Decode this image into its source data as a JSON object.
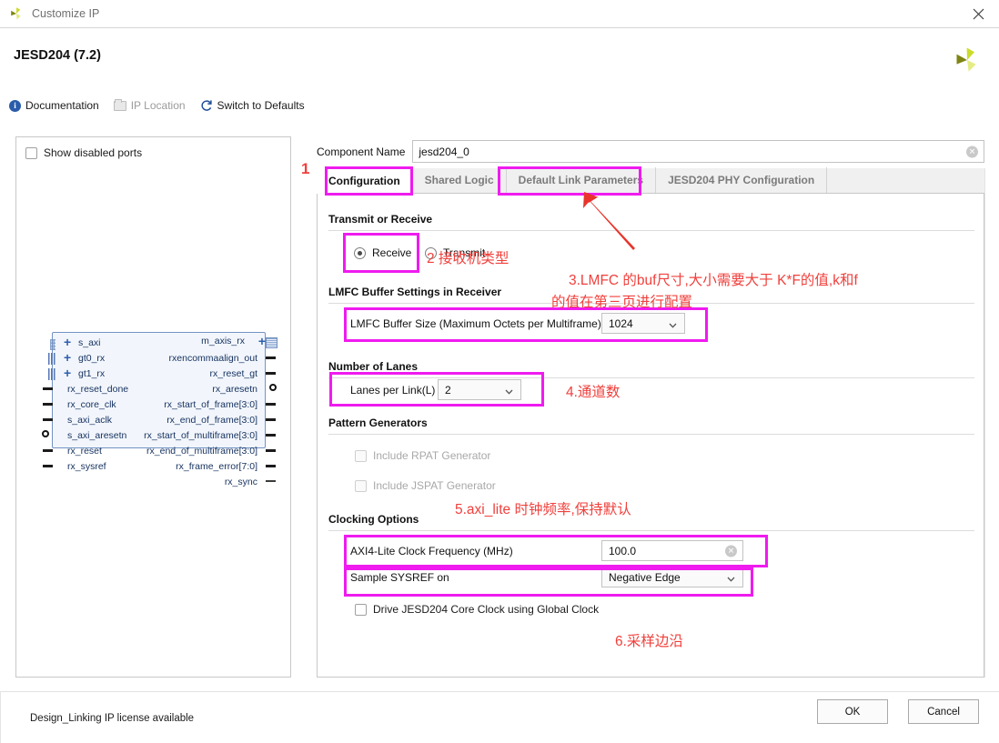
{
  "window": {
    "title": "Customize IP",
    "close_icon": "close-icon",
    "app_icon": "xilinx-logo-icon"
  },
  "header": {
    "page_title": "JESD204 (7.2)",
    "brand_icon": "xilinx-logo-icon",
    "toolbar": [
      {
        "label": "Documentation",
        "icon": "info-icon",
        "dim": false
      },
      {
        "label": "IP Location",
        "icon": "folder-icon",
        "dim": true
      },
      {
        "label": "Switch to Defaults",
        "icon": "refresh-icon",
        "dim": false
      }
    ]
  },
  "left_panel": {
    "show_disabled_ports": {
      "label": "Show disabled ports",
      "checked": false
    },
    "diagram": {
      "left_ports": [
        {
          "label": "s_axi",
          "expandable": true,
          "type": "bus"
        },
        {
          "label": "gt0_rx",
          "expandable": true,
          "type": "bus"
        },
        {
          "label": "gt1_rx",
          "expandable": true,
          "type": "bus"
        },
        {
          "label": "rx_reset_done",
          "expandable": false,
          "type": "pin"
        },
        {
          "label": "rx_core_clk",
          "expandable": false,
          "type": "pin"
        },
        {
          "label": "s_axi_aclk",
          "expandable": false,
          "type": "pin"
        },
        {
          "label": "s_axi_aresetn",
          "expandable": false,
          "type": "pin-inv"
        },
        {
          "label": "rx_reset",
          "expandable": false,
          "type": "pin"
        },
        {
          "label": "rx_sysref",
          "expandable": false,
          "type": "pin"
        }
      ],
      "right_ports": [
        {
          "label": "m_axis_rx",
          "expandable": true,
          "type": "bus"
        },
        {
          "label": "rxencommaalign_out",
          "expandable": false,
          "type": "pin"
        },
        {
          "label": "rx_reset_gt",
          "expandable": false,
          "type": "pin"
        },
        {
          "label": "rx_aresetn",
          "expandable": false,
          "type": "pin-inv"
        },
        {
          "label": "rx_start_of_frame[3:0]",
          "expandable": false,
          "type": "vec"
        },
        {
          "label": "rx_end_of_frame[3:0]",
          "expandable": false,
          "type": "vec"
        },
        {
          "label": "rx_start_of_multiframe[3:0]",
          "expandable": false,
          "type": "vec"
        },
        {
          "label": "rx_end_of_multiframe[3:0]",
          "expandable": false,
          "type": "vec"
        },
        {
          "label": "rx_frame_error[7:0]",
          "expandable": false,
          "type": "vec"
        },
        {
          "label": "rx_sync",
          "expandable": false,
          "type": "pin"
        }
      ]
    }
  },
  "component_name": {
    "label": "Component Name",
    "value": "jesd204_0",
    "clear_icon": "clear-icon"
  },
  "tabs": [
    {
      "label": "Configuration",
      "active": true
    },
    {
      "label": "Shared Logic",
      "active": false
    },
    {
      "label": "Default Link Parameters",
      "active": false
    },
    {
      "label": "JESD204 PHY Configuration",
      "active": false
    }
  ],
  "configuration": {
    "transmit_or_receive": {
      "title": "Transmit or Receive",
      "options": [
        {
          "label": "Receive",
          "selected": true
        },
        {
          "label": "Transmit",
          "selected": false
        }
      ]
    },
    "lmfc_buffer": {
      "title": "LMFC Buffer Settings in Receiver",
      "field_label": "LMFC Buffer Size (Maximum Octets per Multiframe)",
      "value": "1024"
    },
    "number_of_lanes": {
      "title": "Number of Lanes",
      "field_label": "Lanes per Link(L)",
      "value": "2"
    },
    "pattern_generators": {
      "title": "Pattern Generators",
      "items": [
        {
          "label": "Include RPAT Generator",
          "checked": false,
          "enabled": false
        },
        {
          "label": "Include JSPAT Generator",
          "checked": false,
          "enabled": false
        }
      ]
    },
    "clocking_options": {
      "title": "Clocking Options",
      "axi_clock": {
        "label": "AXI4-Lite Clock Frequency (MHz)",
        "value": "100.0",
        "clear_icon": "clear-icon"
      },
      "sysref": {
        "label": "Sample SYSREF on",
        "value": "Negative Edge"
      },
      "global_clock": {
        "label": "Drive JESD204 Core Clock using Global Clock",
        "checked": false
      }
    }
  },
  "annotations": {
    "accent_color": "#ef1bef",
    "note_color": "#f0403c",
    "notes": [
      {
        "id": "n1",
        "text": "1"
      },
      {
        "id": "n2",
        "text": "2 接收机类型"
      },
      {
        "id": "n3a",
        "text": "3.LMFC 的buf尺寸,大小需要大于 K*F的值,k和f"
      },
      {
        "id": "n3b",
        "text": "的值在第三页进行配置"
      },
      {
        "id": "n4",
        "text": "4.通道数"
      },
      {
        "id": "n5",
        "text": "5.axi_lite 时钟频率,保持默认"
      },
      {
        "id": "n6",
        "text": "6.采样边沿"
      }
    ]
  },
  "footer": {
    "license": "Design_Linking IP license available",
    "ok": "OK",
    "cancel": "Cancel"
  }
}
